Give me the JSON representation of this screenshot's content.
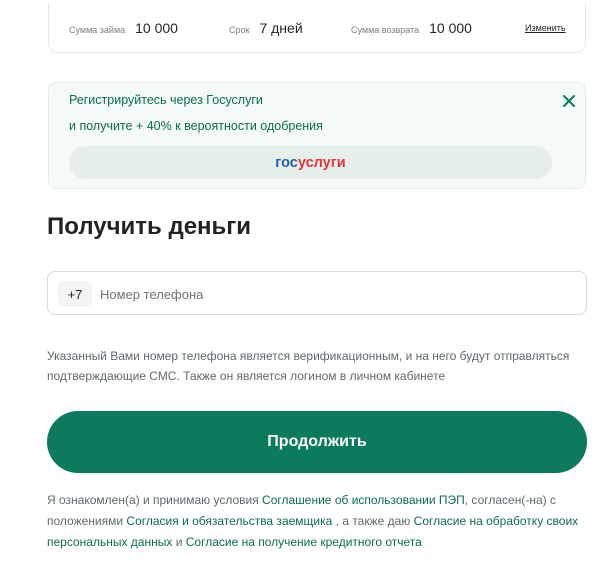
{
  "summary": {
    "amount_label": "Сумма займа",
    "amount_value": "10 000",
    "term_label": "Срок",
    "term_value": "7 дней",
    "return_label": "Сумма возврата",
    "return_value": "10 000",
    "change_link": "Изменить"
  },
  "gosuslugi_banner": {
    "title": "Регистрируйтесь через Госуслуги",
    "subtitle": "и получите + 40% к вероятности одобрения",
    "button_part1": "гос",
    "button_part2": "услуги",
    "close_icon": "close-icon"
  },
  "heading": "Получить деньги",
  "phone": {
    "prefix": "+7",
    "placeholder": "Номер телефона",
    "value": ""
  },
  "hint": "Указанный Вами номер телефона является верификационным, и на него будут отправляться подтверждающие СМС. Также он является логином в личном кабинете",
  "continue_button": "Продолжить",
  "consent": {
    "t1": "Я ознакомлен(а) и принимаю условия ",
    "link1": "Соглашение об использовании ПЭП",
    "t2": ", согласен(-на) с положениями ",
    "link2": "Согласия и обязательства заемщика",
    "t3": " , а также даю ",
    "link3": "Согласие на обработку своих персональных данных",
    "t4": " и ",
    "link4": "Согласие на получение кредитного отчета"
  },
  "colors": {
    "accent": "#0b7a5d",
    "link": "#0a6b52",
    "banner_bg": "#f4faf6",
    "gos_blue": "#1f5ea8",
    "gos_red": "#e4353a"
  }
}
